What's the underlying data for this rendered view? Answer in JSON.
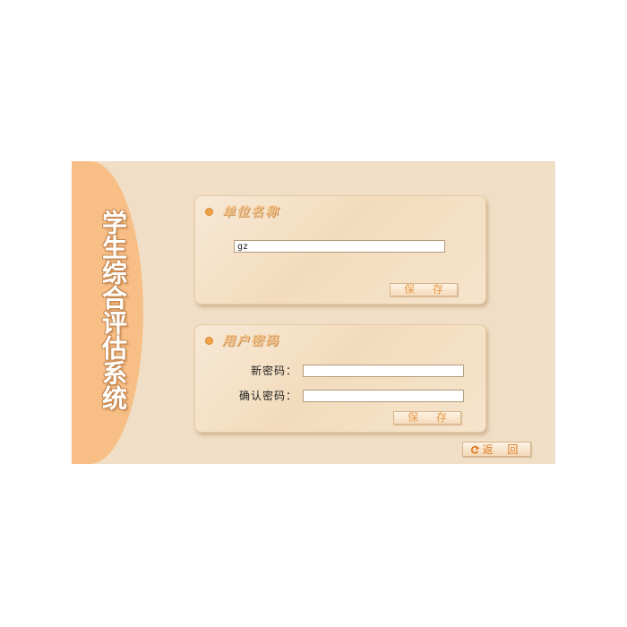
{
  "sidebar": {
    "title": "学生综合评估系统"
  },
  "unit_panel": {
    "title": "单位名称",
    "unit_name_value": "gz",
    "save_label": "保 存"
  },
  "password_panel": {
    "title": "用户密码",
    "new_password_label": "新密码：",
    "new_password_value": "",
    "confirm_password_label": "确认密码：",
    "confirm_password_value": "",
    "save_label": "保 存"
  },
  "back_button": {
    "label": "返 回",
    "icon": "back-arrow-icon"
  },
  "colors": {
    "background": "#f0dfc6",
    "banner": "#f7be86",
    "accent": "#e89a46"
  }
}
